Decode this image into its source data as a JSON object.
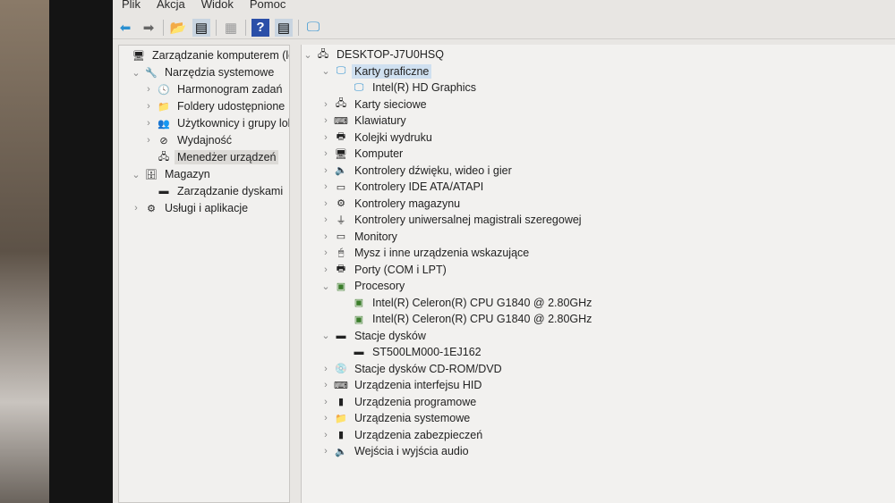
{
  "menu": [
    "Plik",
    "Akcja",
    "Widok",
    "Pomoc"
  ],
  "left_tree": [
    {
      "label": "Zarządzanie komputerem (lokalne)",
      "level": 0,
      "chev": "",
      "icon": "computer-management-icon",
      "glyph": "🖥"
    },
    {
      "label": "Narzędzia systemowe",
      "level": 1,
      "chev": "v",
      "icon": "tools-icon",
      "glyph": "🔧"
    },
    {
      "label": "Harmonogram zadań",
      "level": 2,
      "chev": ">",
      "icon": "clock-icon",
      "glyph": "🕓"
    },
    {
      "label": "Foldery udostępnione",
      "level": 2,
      "chev": ">",
      "icon": "shared-folder-icon",
      "glyph": "📁"
    },
    {
      "label": "Użytkownicy i grupy lokalne",
      "level": 2,
      "chev": ">",
      "icon": "users-icon",
      "glyph": "👥"
    },
    {
      "label": "Wydajność",
      "level": 2,
      "chev": ">",
      "icon": "performance-icon",
      "glyph": "⊘"
    },
    {
      "label": "Menedżer urządzeń",
      "level": 2,
      "chev": "",
      "icon": "device-manager-icon",
      "glyph": "🖧",
      "selected": true
    },
    {
      "label": "Magazyn",
      "level": 1,
      "chev": "v",
      "icon": "storage-icon",
      "glyph": "🗄"
    },
    {
      "label": "Zarządzanie dyskami",
      "level": 2,
      "chev": "",
      "icon": "disk-icon",
      "glyph": "▬"
    },
    {
      "label": "Usługi i aplikacje",
      "level": 1,
      "chev": ">",
      "icon": "services-icon",
      "glyph": "⚙"
    }
  ],
  "right_tree": [
    {
      "label": "DESKTOP-J7U0HSQ",
      "level": 0,
      "chev": "v",
      "icon": "computer-icon",
      "glyph": "🖧"
    },
    {
      "label": "Karty graficzne",
      "level": 1,
      "chev": "v",
      "icon": "display-adapter-icon",
      "glyph": "🖵",
      "selected": true
    },
    {
      "label": "Intel(R) HD Graphics",
      "level": 2,
      "chev": "",
      "icon": "display-adapter-icon",
      "glyph": "🖵"
    },
    {
      "label": "Karty sieciowe",
      "level": 1,
      "chev": ">",
      "icon": "network-icon",
      "glyph": "🖧"
    },
    {
      "label": "Klawiatury",
      "level": 1,
      "chev": ">",
      "icon": "keyboard-icon",
      "glyph": "⌨"
    },
    {
      "label": "Kolejki wydruku",
      "level": 1,
      "chev": ">",
      "icon": "printer-icon",
      "glyph": "🖶"
    },
    {
      "label": "Komputer",
      "level": 1,
      "chev": ">",
      "icon": "monitor-icon",
      "glyph": "🖥"
    },
    {
      "label": "Kontrolery dźwięku, wideo i gier",
      "level": 1,
      "chev": ">",
      "icon": "sound-icon",
      "glyph": "🔈"
    },
    {
      "label": "Kontrolery IDE ATA/ATAPI",
      "level": 1,
      "chev": ">",
      "icon": "ide-icon",
      "glyph": "▭"
    },
    {
      "label": "Kontrolery magazynu",
      "level": 1,
      "chev": ">",
      "icon": "storage-controller-icon",
      "glyph": "⚙"
    },
    {
      "label": "Kontrolery uniwersalnej magistrali szeregowej",
      "level": 1,
      "chev": ">",
      "icon": "usb-icon",
      "glyph": "⏚"
    },
    {
      "label": "Monitory",
      "level": 1,
      "chev": ">",
      "icon": "monitor-icon",
      "glyph": "▭"
    },
    {
      "label": "Mysz i inne urządzenia wskazujące",
      "level": 1,
      "chev": ">",
      "icon": "mouse-icon",
      "glyph": "🖱"
    },
    {
      "label": "Porty (COM i LPT)",
      "level": 1,
      "chev": ">",
      "icon": "port-icon",
      "glyph": "🖶"
    },
    {
      "label": "Procesory",
      "level": 1,
      "chev": "v",
      "icon": "processor-icon",
      "glyph": "▣"
    },
    {
      "label": "Intel(R) Celeron(R) CPU G1840 @ 2.80GHz",
      "level": 2,
      "chev": "",
      "icon": "processor-icon",
      "glyph": "▣"
    },
    {
      "label": "Intel(R) Celeron(R) CPU G1840 @ 2.80GHz",
      "level": 2,
      "chev": "",
      "icon": "processor-icon",
      "glyph": "▣"
    },
    {
      "label": "Stacje dysków",
      "level": 1,
      "chev": "v",
      "icon": "disk-drive-icon",
      "glyph": "▬"
    },
    {
      "label": "ST500LM000-1EJ162",
      "level": 2,
      "chev": "",
      "icon": "disk-drive-icon",
      "glyph": "▬"
    },
    {
      "label": "Stacje dysków CD-ROM/DVD",
      "level": 1,
      "chev": ">",
      "icon": "cdrom-icon",
      "glyph": "💿"
    },
    {
      "label": "Urządzenia interfejsu HID",
      "level": 1,
      "chev": ">",
      "icon": "hid-icon",
      "glyph": "⌨"
    },
    {
      "label": "Urządzenia programowe",
      "level": 1,
      "chev": ">",
      "icon": "software-device-icon",
      "glyph": "▮"
    },
    {
      "label": "Urządzenia systemowe",
      "level": 1,
      "chev": ">",
      "icon": "system-device-icon",
      "glyph": "📁"
    },
    {
      "label": "Urządzenia zabezpieczeń",
      "level": 1,
      "chev": ">",
      "icon": "security-device-icon",
      "glyph": "▮"
    },
    {
      "label": "Wejścia i wyjścia audio",
      "level": 1,
      "chev": ">",
      "icon": "audio-io-icon",
      "glyph": "🔈"
    }
  ],
  "colors": {
    "selection": "#cfe0f0",
    "processor": "#3a7d2a",
    "display": "#2a8fd0"
  }
}
